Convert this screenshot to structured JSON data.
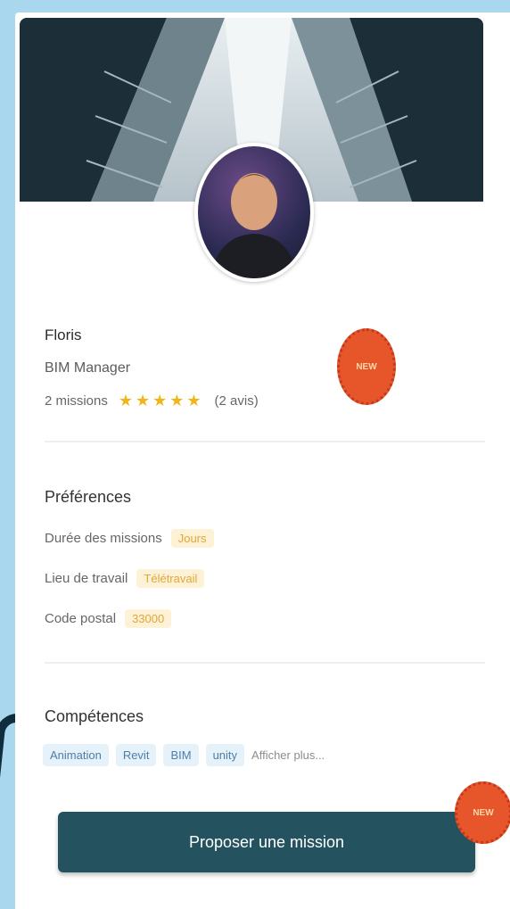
{
  "profile": {
    "name": "Floris",
    "role": "BIM Manager",
    "missions": "2 missions",
    "stars": "★★★★★",
    "reviews": "(2 avis)",
    "badge_label": "NEW"
  },
  "preferences": {
    "title": "Préférences",
    "rows": [
      {
        "label": "Durée des missions",
        "value": "Jours"
      },
      {
        "label": "Lieu de travail",
        "value": "Télétravail"
      },
      {
        "label": "Code postal",
        "value": "33000"
      }
    ]
  },
  "skills": {
    "title": "Compétences",
    "items": [
      "Animation",
      "Revit",
      "BIM",
      "unity"
    ],
    "more": "Afficher plus..."
  },
  "cta": {
    "label": "Proposer une mission",
    "badge_label": "NEW"
  },
  "colors": {
    "page_background": "#a9d7ee",
    "button": "#24535f",
    "badge": "#e7552b",
    "star": "#f1b51a",
    "pill": "#fdf2d6",
    "skill_tag": "#e6f2f9"
  }
}
